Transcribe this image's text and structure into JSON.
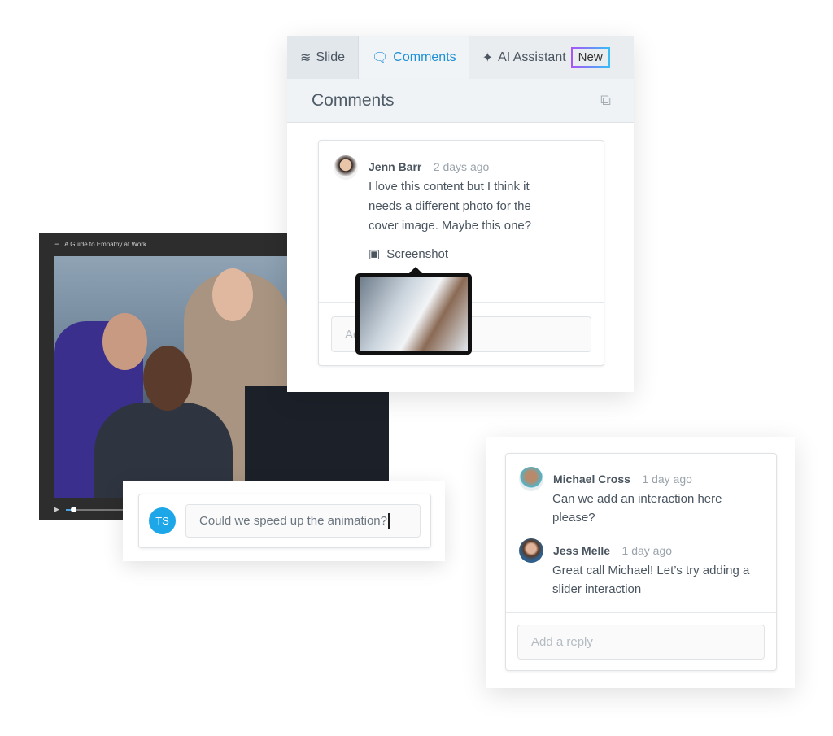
{
  "player": {
    "title": "A Guide to Empathy at Work"
  },
  "panel": {
    "tabs": [
      {
        "label": "Slide",
        "icon": "layers-icon"
      },
      {
        "label": "Comments",
        "icon": "speech-bubble-icon",
        "active": true
      },
      {
        "label": "AI Assistant",
        "icon": "sparkles-icon",
        "badge": "New"
      }
    ],
    "header": "Comments",
    "comment": {
      "author": "Jenn Barr",
      "time": "2 days ago",
      "text": "I love this content but I think it needs a different photo for the cover image. Maybe this one?",
      "attachment": "Screenshot"
    },
    "reply_placeholder": "Add a reply"
  },
  "quick_comment": {
    "initials": "TS",
    "value": "Could we speed up the animation?",
    "avatar_color": "#1ea7e8"
  },
  "thread": {
    "comments": [
      {
        "author": "Michael Cross",
        "time": "1 day ago",
        "text": "Can we add an interaction here please?"
      },
      {
        "author": "Jess Melle",
        "time": "1 day ago",
        "text": "Great call Michael! Let’s try adding a slider interaction"
      }
    ],
    "reply_placeholder": "Add a reply"
  },
  "colors": {
    "accent": "#1e8fd6",
    "badge_gradient": [
      "#a855f7",
      "#38bdf8"
    ]
  }
}
